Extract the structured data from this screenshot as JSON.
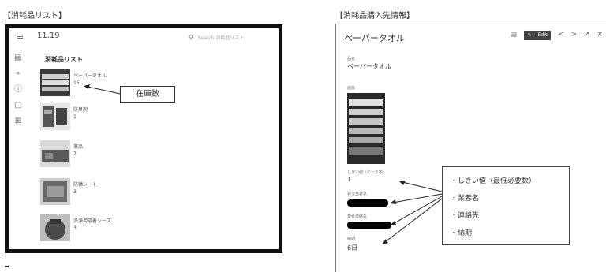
{
  "captions": {
    "left": "【消耗品リスト】",
    "right": "【消耗品購入先情報】"
  },
  "list_screen": {
    "title": "11.19",
    "search_placeholder": "Search 消耗品リスト",
    "section_title": "消耗品リスト",
    "rail_icons": [
      "book-icon",
      "wrench-icon",
      "info-icon",
      "message-icon",
      "grid-icon"
    ],
    "items": [
      {
        "name": "ペーパータオル",
        "qty": "15"
      },
      {
        "name": "防臭剤",
        "qty": "1"
      },
      {
        "name": "薬品",
        "qty": "7"
      },
      {
        "name": "防錆シート",
        "qty": "3"
      },
      {
        "name": "洗浄用吸着シーズ",
        "qty": "3"
      }
    ],
    "callout": "在庫数"
  },
  "detail_screen": {
    "title": "ペーパータオル",
    "edit_label": "Edit",
    "fields": {
      "name_label": "品名",
      "name_value": "ペーパータオル",
      "photo_label": "画像",
      "min_label": "しきい値（ケース数）",
      "min_value": "1",
      "vendor_label": "発注業者名",
      "contact_label": "業者連絡先",
      "lead_label": "納期",
      "lead_value": "6日"
    },
    "info_box": [
      "・しきい値（最低必要数）",
      "・業者名",
      "・連絡先",
      "・納期"
    ]
  },
  "colors": {
    "frame": "#111111",
    "redaction": "#000000"
  }
}
